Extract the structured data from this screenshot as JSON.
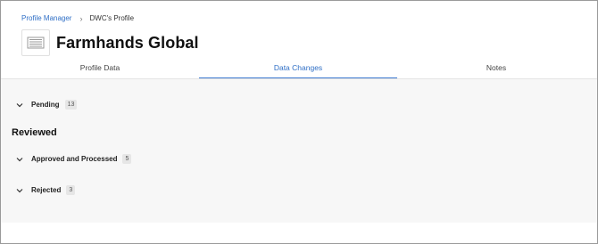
{
  "breadcrumb": {
    "root": "Profile Manager",
    "separator": "›",
    "current": "DWC's Profile"
  },
  "header": {
    "company_name": "Farmhands Global",
    "logo_icon": "building-icon"
  },
  "tabs": [
    {
      "label": "Profile Data",
      "active": false
    },
    {
      "label": "Data Changes",
      "active": true
    },
    {
      "label": "Notes",
      "active": false
    }
  ],
  "sections": {
    "pending": {
      "label": "Pending",
      "count": "13"
    },
    "reviewed_heading": "Reviewed",
    "approved": {
      "label": "Approved and Processed",
      "count": "5"
    },
    "rejected": {
      "label": "Rejected",
      "count": "3"
    }
  },
  "colors": {
    "accent": "#2f6fc6",
    "content_bg": "#f7f7f7",
    "badge_bg": "#e6e6e6"
  }
}
